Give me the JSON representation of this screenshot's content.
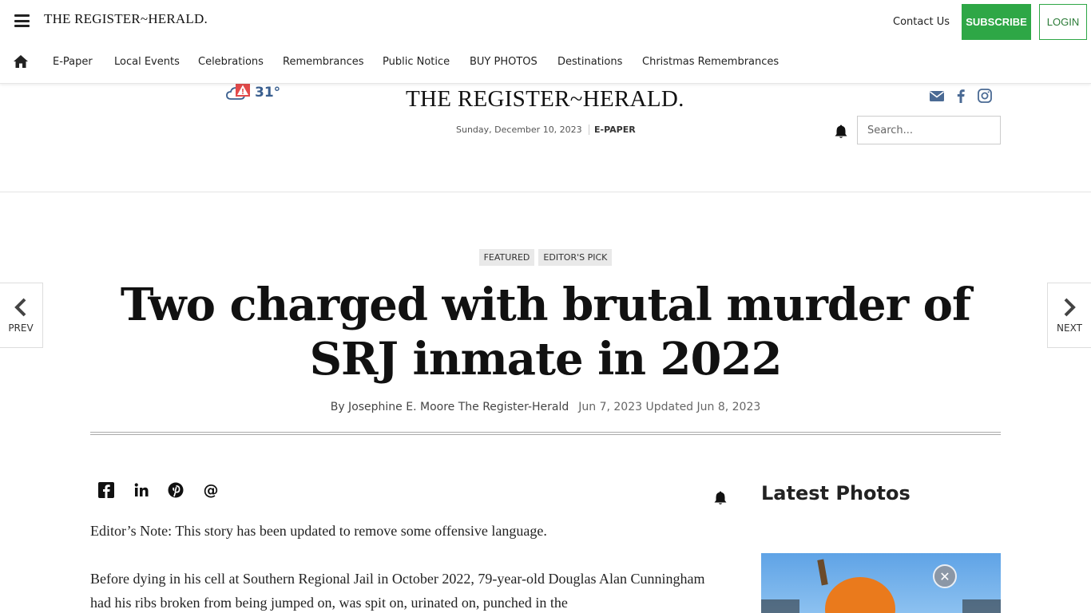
{
  "header": {
    "brand": "THE REGISTER~HERALD.",
    "contact": "Contact Us",
    "subscribe": "SUBSCRIBE",
    "login": "LOGIN"
  },
  "nav": {
    "items": [
      "E-Paper",
      "Local Events",
      "Celebrations",
      "Remembrances",
      "Public Notice",
      "BUY PHOTOS",
      "Destinations",
      "Christmas Remembrances"
    ]
  },
  "masthead": {
    "brand": "THE REGISTER~HERALD.",
    "date": "Sunday, December 10, 2023",
    "epaper": "E-PAPER",
    "temperature": "31°",
    "search_placeholder": "Search..."
  },
  "article": {
    "tags": [
      "FEATURED",
      "EDITOR'S PICK"
    ],
    "headline": "Two charged with brutal murder of SRJ inmate in 2022",
    "byline": "By Josephine E. Moore The Register-Herald",
    "dates": "Jun 7, 2023 Updated Jun 8, 2023",
    "prev": "PREV",
    "next": "NEXT",
    "paragraphs": [
      "Editor’s Note: This story has been updated to remove some offensive language.",
      "Before dying in his cell at Southern Regional Jail in October 2022, 79-year-old Douglas Alan Cunningham had his ribs broken from being jumped on, was spit on, urinated on, punched in the"
    ]
  },
  "sidebar": {
    "title": "Latest Photos"
  },
  "colors": {
    "subscribe_green": "#2ea746",
    "weather_blue": "#3a5f8f",
    "social_blue": "#4a6a94"
  }
}
